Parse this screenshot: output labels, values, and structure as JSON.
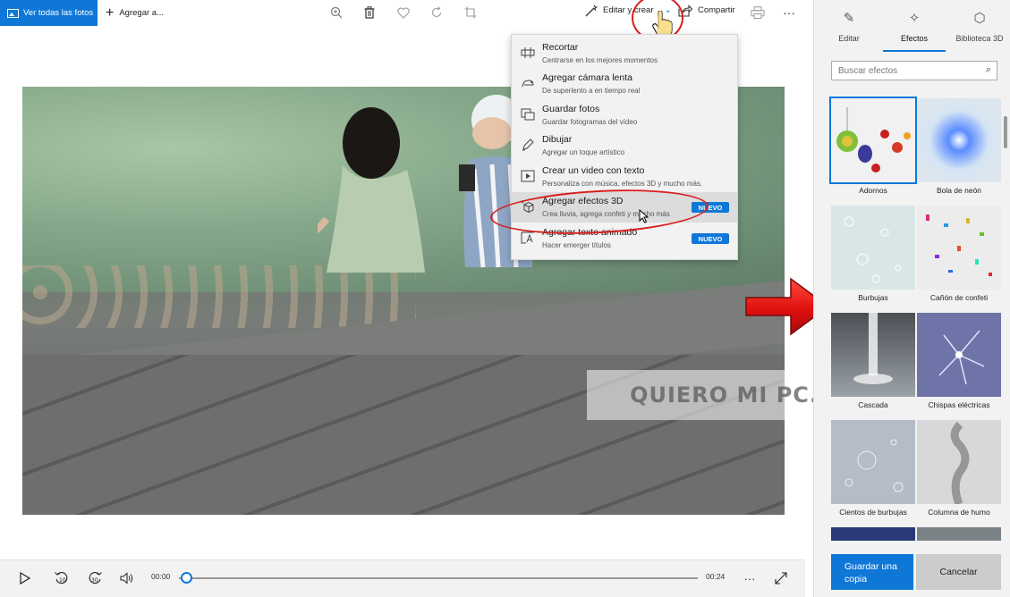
{
  "toolbar": {
    "view_all_label": "Ver todas las fotos",
    "add_to_label": "Agregar a...",
    "edit_create_label": "Editar y crear",
    "share_label": "Compartir"
  },
  "menu": {
    "items": [
      {
        "title": "Recortar",
        "subtitle": "Centrarse en los mejores momentos",
        "icon": "trim-icon"
      },
      {
        "title": "Agregar cámara lenta",
        "subtitle": "De superlento a en tiempo real",
        "icon": "slow-motion-icon"
      },
      {
        "title": "Guardar fotos",
        "subtitle": "Guardar fotogramas del vídeo",
        "icon": "save-frames-icon"
      },
      {
        "title": "Dibujar",
        "subtitle": "Agregar un toque artístico",
        "icon": "pen-icon"
      },
      {
        "title": "Crear un video con texto",
        "subtitle": "Personaliza con música, efectos 3D y mucho más.",
        "icon": "video-text-icon"
      },
      {
        "title": "Agregar efectos 3D",
        "subtitle": "Crea lluvia, agrega confeti y mucho más",
        "icon": "effects-3d-icon",
        "badge": "NUEVO"
      },
      {
        "title": "Agregar texto animado",
        "subtitle": "Hacer emerger títulos",
        "icon": "animated-text-icon",
        "badge": "NUEVO"
      }
    ]
  },
  "watermark": "QUIERO MI PC.COM",
  "player": {
    "current_time": "00:00",
    "total_time": "00:24",
    "progress": 0.0
  },
  "panel": {
    "tabs": [
      {
        "label": "Editar",
        "icon": "pencil-icon"
      },
      {
        "label": "Efectos",
        "icon": "sparkle-icon"
      },
      {
        "label": "Biblioteca 3D",
        "icon": "cube-icon"
      }
    ],
    "active_tab": "Efectos",
    "search_placeholder": "Buscar efectos",
    "effects": [
      {
        "label": "Adornos"
      },
      {
        "label": "Bola de neón"
      },
      {
        "label": "Burbujas"
      },
      {
        "label": "Cañón de confeti"
      },
      {
        "label": "Cascada"
      },
      {
        "label": "Chispas eléctricas"
      },
      {
        "label": "Cientos de burbujas"
      },
      {
        "label": "Columna de humo"
      }
    ],
    "selected_effect": "Adornos",
    "save_copy_label": "Guardar una copia",
    "cancel_label": "Cancelar"
  },
  "colors": {
    "accent": "#0f78d7",
    "highlight_red": "#d81f1f",
    "panel_bg": "#f2f2f2"
  }
}
